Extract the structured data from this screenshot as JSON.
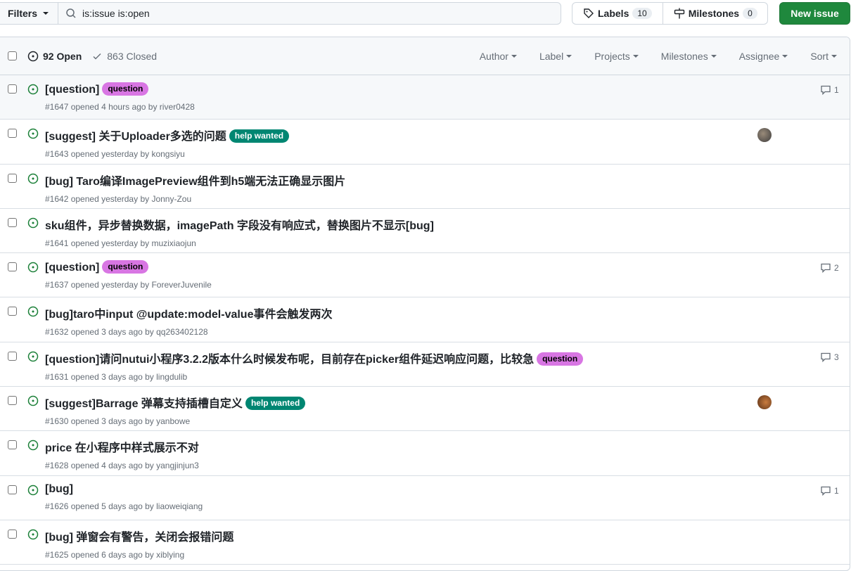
{
  "toolbar": {
    "filters_label": "Filters",
    "search_value": "is:issue is:open",
    "labels_label": "Labels",
    "labels_count": "10",
    "milestones_label": "Milestones",
    "milestones_count": "0",
    "new_issue_label": "New issue"
  },
  "header": {
    "open_label": "92 Open",
    "closed_label": "863 Closed",
    "filters": [
      "Author",
      "Label",
      "Projects",
      "Milestones",
      "Assignee",
      "Sort"
    ]
  },
  "colors": {
    "open": "#1a7f37",
    "question": "#d876e3",
    "help_wanted": "#008672",
    "primary": "#1f883d"
  },
  "issues": [
    {
      "title": "[question]",
      "label": "question",
      "meta": "#1647 opened 4 hours ago by river0428",
      "comments": "1"
    },
    {
      "title": "[suggest] 关于Uploader多选的问题",
      "label": "help wanted",
      "meta": "#1643 opened yesterday by kongsiyu",
      "avatar": "a"
    },
    {
      "title": "[bug] Taro编译ImagePreview组件到h5端无法正确显示图片",
      "meta": "#1642 opened yesterday by Jonny-Zou"
    },
    {
      "title": "sku组件，异步替换数据，imagePath 字段没有响应式，替换图片不显示[bug]",
      "meta": "#1641 opened yesterday by muzixiaojun"
    },
    {
      "title": "[question]",
      "label": "question",
      "meta": "#1637 opened yesterday by ForeverJuvenile",
      "comments": "2"
    },
    {
      "title": "[bug]taro中input @update:model-value事件会触发两次",
      "meta": "#1632 opened 3 days ago by qq263402128"
    },
    {
      "title": "[question]请问nutui小程序3.2.2版本什么时候发布呢，目前存在picker组件延迟响应问题，比较急",
      "label": "question",
      "meta": "#1631 opened 3 days ago by lingdulib",
      "comments": "3"
    },
    {
      "title": "[suggest]Barrage 弹幕支持插槽自定义",
      "label": "help wanted",
      "meta": "#1630 opened 3 days ago by yanbowe",
      "avatar": "b"
    },
    {
      "title": "price 在小程序中样式展示不对",
      "meta": "#1628 opened 4 days ago by yangjinjun3"
    },
    {
      "title": "[bug]",
      "meta": "#1626 opened 5 days ago by liaoweiqiang",
      "comments": "1"
    },
    {
      "title": "[bug] 弹窗会有警告，关闭会报错问题",
      "meta": "#1625 opened 6 days ago by xiblying"
    }
  ]
}
